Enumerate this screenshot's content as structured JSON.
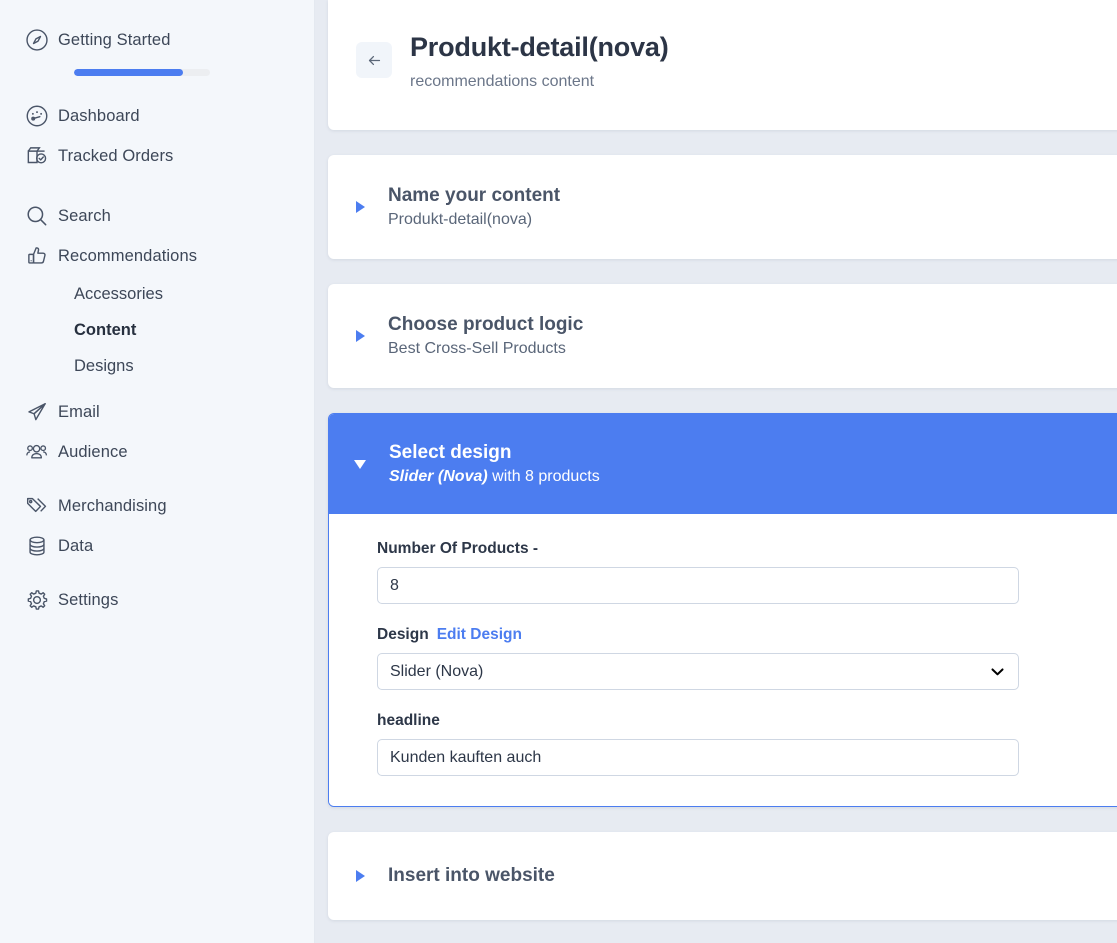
{
  "sidebar": {
    "items": [
      {
        "label": "Getting Started",
        "icon": "compass-icon",
        "type": "item",
        "progress": 80
      },
      {
        "label": "Dashboard",
        "icon": "gauge-icon",
        "type": "item"
      },
      {
        "label": "Tracked Orders",
        "icon": "box-check-icon",
        "type": "item"
      },
      {
        "label": "Search",
        "icon": "search-icon",
        "type": "item"
      },
      {
        "label": "Recommendations",
        "icon": "thumbs-up-icon",
        "type": "item"
      },
      {
        "label": "Accessories",
        "type": "sub",
        "active": false
      },
      {
        "label": "Content",
        "type": "sub",
        "active": true
      },
      {
        "label": "Designs",
        "type": "sub",
        "active": false
      },
      {
        "label": "Email",
        "icon": "paper-plane-icon",
        "type": "item"
      },
      {
        "label": "Audience",
        "icon": "users-icon",
        "type": "item"
      },
      {
        "label": "Merchandising",
        "icon": "tags-icon",
        "type": "item"
      },
      {
        "label": "Data",
        "icon": "database-icon",
        "type": "item"
      },
      {
        "label": "Settings",
        "icon": "gear-icon",
        "type": "item"
      }
    ]
  },
  "header": {
    "back_icon": "arrow-left-icon",
    "title": "Produkt-detail(nova)",
    "subtitle": "recommendations content"
  },
  "sections": [
    {
      "title": "Name your content",
      "subtitle": "Produkt-detail(nova)",
      "expanded": false,
      "toggle_icon": "triangle-right-icon"
    },
    {
      "title": "Choose product logic",
      "subtitle": "Best Cross-Sell Products",
      "expanded": false,
      "toggle_icon": "triangle-right-icon"
    }
  ],
  "select_design": {
    "title": "Select design",
    "subtitle_emphasis": "Slider (Nova)",
    "subtitle_rest": " with 8 products",
    "expanded": true,
    "toggle_icon": "triangle-down-icon",
    "fields": {
      "number_of_products": {
        "label": "Number Of Products -",
        "value": "8",
        "placeholder": ""
      },
      "design": {
        "label": "Design",
        "link_label": "Edit Design",
        "value": "Slider (Nova)",
        "chevron_icon": "chevron-down-icon",
        "options": [
          "Slider (Nova)"
        ]
      },
      "headline": {
        "label": "headline",
        "value": "Kunden kauften auch",
        "placeholder": ""
      }
    }
  },
  "insert_section": {
    "title": "Insert into website",
    "expanded": false,
    "toggle_icon": "triangle-right-icon"
  },
  "colors": {
    "accent": "#4c7df0",
    "sidebar_bg": "#f4f7fb",
    "content_bg": "#e7ebf2",
    "card_bg": "#ffffff",
    "heading": "#4a5568",
    "muted_text": "#6b7689"
  }
}
